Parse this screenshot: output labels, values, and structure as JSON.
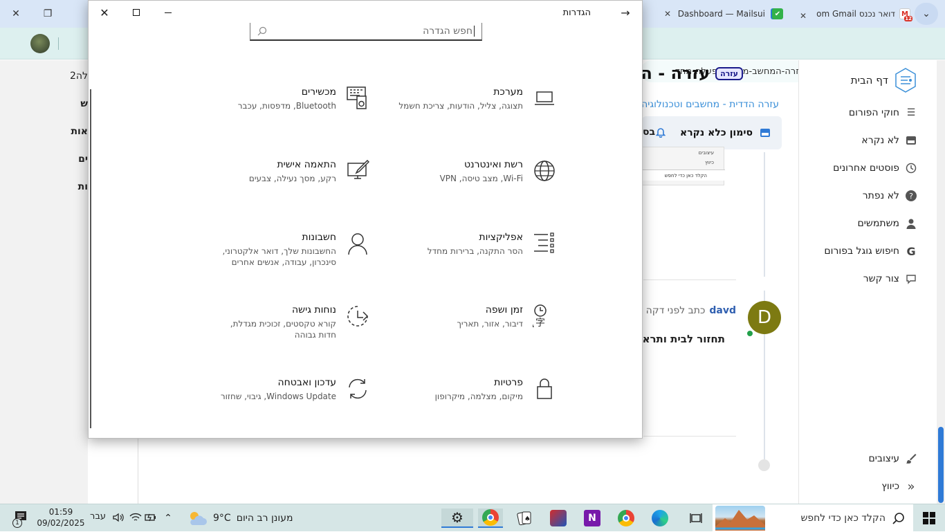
{
  "browser": {
    "tabs": [
      {
        "label": "דואר נכנס Gmail ‏om",
        "active": false
      },
      {
        "label": "Dashboard — Mailsui",
        "active": false
      },
      {
        "label": "",
        "active": true
      }
    ],
    "gmail_badge": "12",
    "address": "עזרה-עזרה-המחשב-מבצע-הפעלה-מחד"
  },
  "forum": {
    "nav_items": [
      {
        "label": "דף הבית",
        "icon": "home-logo"
      },
      {
        "label": "חוקי הפורום",
        "icon": "list-icon"
      },
      {
        "label": "לא נקרא",
        "icon": "inbox-icon"
      },
      {
        "label": "פוסטים אחרונים",
        "icon": "clock-icon"
      },
      {
        "label": "לא נפתר",
        "icon": "question-icon"
      },
      {
        "label": "משתמשים",
        "icon": "user-icon"
      },
      {
        "label": "חיפוש גוגל בפורום",
        "icon": "google-icon"
      },
      {
        "label": "צור קשר",
        "icon": "chat-icon"
      }
    ],
    "bottom_items": [
      {
        "label": "עיצובים",
        "icon": "brush-icon"
      },
      {
        "label": "כיווץ",
        "icon": "collapse-icon"
      }
    ],
    "topic_title": "עזרה - המחשב",
    "topic_badge": "עזרה",
    "breadcrumb": "עזרה הדדית - מחשבים וטכנולוגיה",
    "mark_read": "סימון כלא נקרא",
    "post_author": "davd",
    "post_meta": "כתב לפני דקה",
    "post_body": "תחזור לבית ותראה",
    "avatar_letter": "D",
    "thumb_lines": [
      "עיצובים",
      "כיווץ",
      "הקלד כאן כדי לחפש"
    ],
    "left_strip": [
      "לה2",
      "ש",
      "אות",
      "ים",
      "ות"
    ]
  },
  "settings": {
    "title": "הגדרות",
    "search_placeholder": "חפש הגדרה",
    "categories": [
      {
        "name": "מערכת",
        "desc": "תצוגה, צליל, הודעות, צריכת חשמל",
        "icon": "laptop-icon"
      },
      {
        "name": "מכשירים",
        "desc": "Bluetooth, מדפסות, עכבר",
        "icon": "devices-icon"
      },
      {
        "name": "רשת ואינטרנט",
        "desc": "Wi-Fi, מצב טיסה, VPN",
        "icon": "globe-icon"
      },
      {
        "name": "התאמה אישית",
        "desc": "רקע, מסך נעילה, צבעים",
        "icon": "personalization-icon"
      },
      {
        "name": "אפליקציות",
        "desc": "הסר התקנה, ברירות מחדל",
        "icon": "apps-icon"
      },
      {
        "name": "חשבונות",
        "desc": "החשבונות שלך, דואר אלקטרוני, סינכרון, עבודה, אנשים אחרים",
        "icon": "account-icon"
      },
      {
        "name": "זמן ושפה",
        "desc": "דיבור, אזור, תאריך",
        "icon": "time-language-icon"
      },
      {
        "name": "נוחות גישה",
        "desc": "קורא טקסטים, זכוכית מגדלת, חדות גבוהה",
        "icon": "ease-of-access-icon"
      },
      {
        "name": "פרטיות",
        "desc": "מיקום, מצלמה, מיקרופון",
        "icon": "lock-icon"
      },
      {
        "name": "עדכון ואבטחה",
        "desc": "Windows Update, גיבוי, שחזור",
        "icon": "update-icon"
      }
    ]
  },
  "taskbar": {
    "search_placeholder": "הקלד כאן כדי לחפש",
    "weather_temp": "9°C",
    "weather_desc": "מעונן רב היום",
    "lang": "עבר",
    "time": "01:59",
    "date": "09/02/2025",
    "notif_count": "1"
  },
  "colors": {
    "accent": "#2f7ad6",
    "avatar_bg": "#7d7a12",
    "taskbar_bg": "#d6e6e6"
  }
}
